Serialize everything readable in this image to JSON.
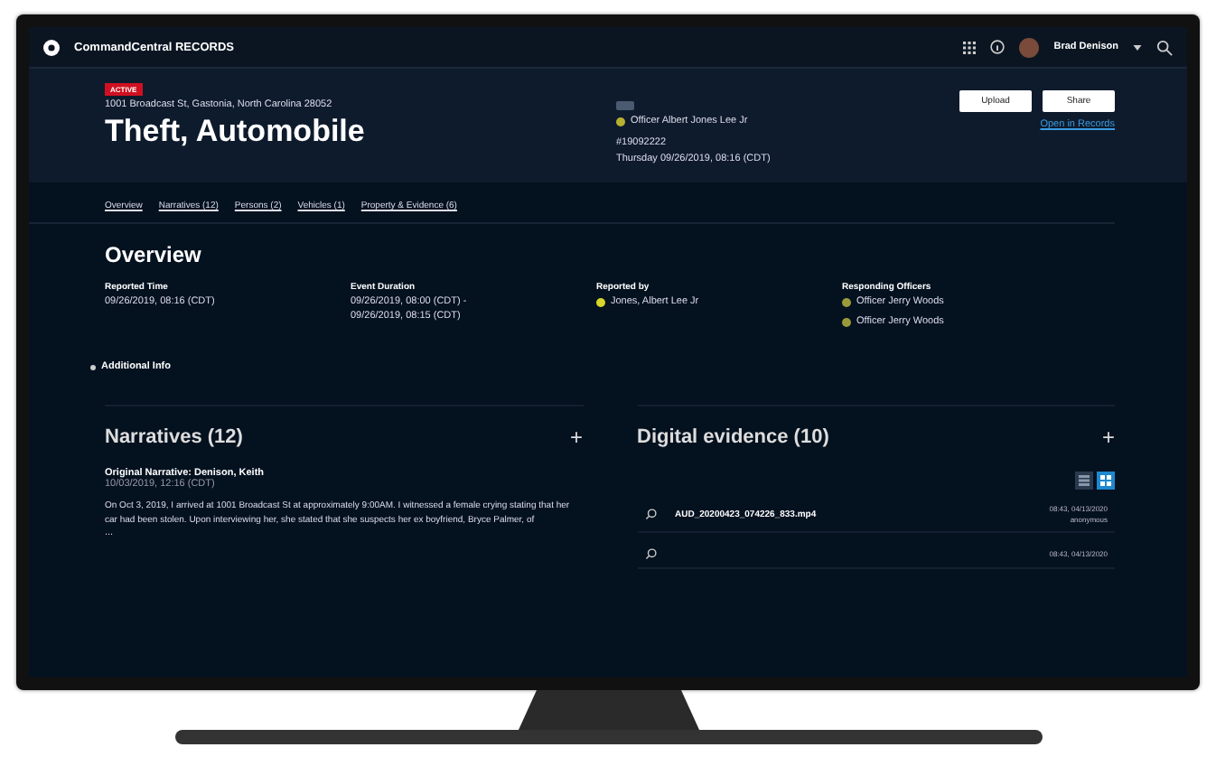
{
  "app": {
    "title": "CommandCentral RECORDS",
    "user": "Brad Denison"
  },
  "incident": {
    "status": "ACTIVE",
    "address": "1001 Broadcast St, Gastonia, North Carolina 28052",
    "title": "Theft, Automobile",
    "officer": "Officer Albert Jones Lee Jr",
    "number": "#19092222",
    "date": "Thursday 09/26/2019, 08:16 (CDT)",
    "buttons": [
      "Upload",
      "Share"
    ],
    "link": "Open in Records"
  },
  "tabs": [
    {
      "label": "Overview"
    },
    {
      "label": "Narratives (12)"
    },
    {
      "label": "Persons (2)"
    },
    {
      "label": "Vehicles (1)"
    },
    {
      "label": "Property & Evidence (6)"
    }
  ],
  "overview": {
    "title": "Overview",
    "fields": [
      {
        "label": "Reported Time",
        "values": [
          "09/26/2019, 08:16 (CDT)"
        ]
      },
      {
        "label": "Event Duration",
        "values": [
          "09/26/2019, 08:00 (CDT) -",
          "09/26/2019, 08:15 (CDT)"
        ]
      },
      {
        "label": "Reported by",
        "people": [
          {
            "name": "Jones, Albert Lee Jr",
            "color": "#d6d62a"
          }
        ]
      },
      {
        "label": "Responding Officers",
        "people": [
          {
            "name": "Officer Jerry Woods",
            "color": "#9a9a3a"
          },
          {
            "name": "Officer Jerry Woods",
            "color": "#9a9a3a"
          }
        ]
      }
    ],
    "more": "Additional Info"
  },
  "narratives": {
    "title": "Narratives (12)",
    "add": "+",
    "item": {
      "title": "Original Narrative: Denison, Keith",
      "date": "10/03/2019, 12:16 (CDT)",
      "text": "On Oct 3, 2019, I arrived at 1001 Broadcast St at approximately 9:00AM. I witnessed a female crying stating that her car had been stolen. Upon interviewing her, she stated that she suspects her ex boyfriend, Bryce Palmer, of",
      "more": "..."
    }
  },
  "evidence": {
    "title": "Digital evidence (10)",
    "add": "+",
    "views": [
      {
        "kind": "list",
        "selected": false
      },
      {
        "kind": "grid",
        "selected": true
      }
    ],
    "items": [
      {
        "name": "AUD_20200423_074226_833.mp4",
        "time": "08:43, 04/13/2020",
        "owner": "anonymous"
      },
      {
        "time": "08:43, 04/13/2020"
      }
    ]
  }
}
